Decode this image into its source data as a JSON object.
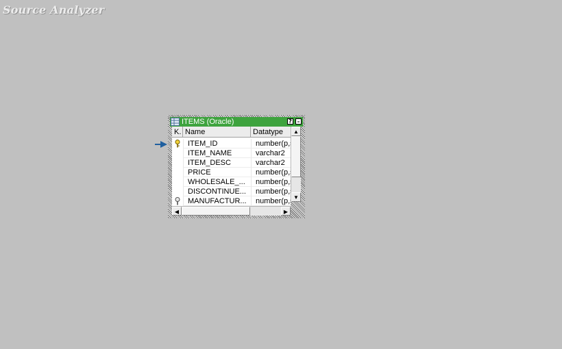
{
  "workspace": {
    "title": "Source Analyzer"
  },
  "source_window": {
    "title": "ITEMS (Oracle)",
    "help_label": "?",
    "minimize_label": "–",
    "columns": {
      "key": "K.",
      "name": "Name",
      "datatype": "Datatype"
    },
    "rows": [
      {
        "key": "primary-key",
        "name": "ITEM_ID",
        "datatype": "number(p,s"
      },
      {
        "key": "",
        "name": "ITEM_NAME",
        "datatype": "varchar2"
      },
      {
        "key": "",
        "name": "ITEM_DESC",
        "datatype": "varchar2"
      },
      {
        "key": "",
        "name": "PRICE",
        "datatype": "number(p,s"
      },
      {
        "key": "",
        "name": "WHOLESALE_...",
        "datatype": "number(p,s"
      },
      {
        "key": "",
        "name": "DISCONTINUE...",
        "datatype": "number(p,s"
      },
      {
        "key": "foreign-key",
        "name": "MANUFACTUR...",
        "datatype": "number(p,s"
      }
    ],
    "scroll": {
      "up": "▲",
      "down": "▼",
      "left": "◀",
      "right": "▶"
    }
  },
  "colors": {
    "titlebar": "#3ea33e",
    "workspace": "#c0c0c0",
    "link_arrow": "#1f5f9f"
  }
}
